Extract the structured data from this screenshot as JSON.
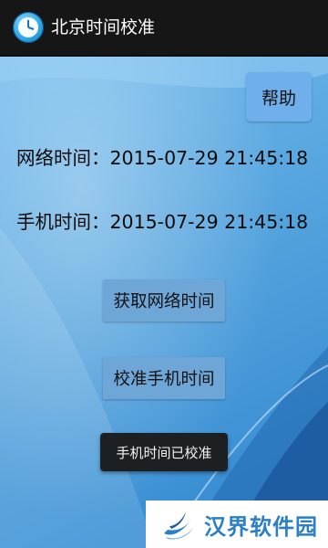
{
  "app": {
    "title": "北京时间校准",
    "icon": "clock-icon"
  },
  "help_button": {
    "label": "帮助"
  },
  "network_time": {
    "label": "网络时间：",
    "value": "2015-07-29 21:45:18"
  },
  "phone_time": {
    "label": "手机时间：",
    "value": "2015-07-29 21:45:18"
  },
  "buttons": {
    "fetch_label": "获取网络时间",
    "calibrate_label": "校准手机时间"
  },
  "toast": {
    "message": "手机时间已校准"
  },
  "watermark": {
    "text": "汉界软件园",
    "icon": "hanjie-logo"
  },
  "colors": {
    "titlebar": "#161616",
    "background": "#5fa9de",
    "button": "#6fa6d8",
    "help_button": "#6fb0ec",
    "toast": "#1d2023",
    "watermark_text": "#2a7fc6"
  }
}
